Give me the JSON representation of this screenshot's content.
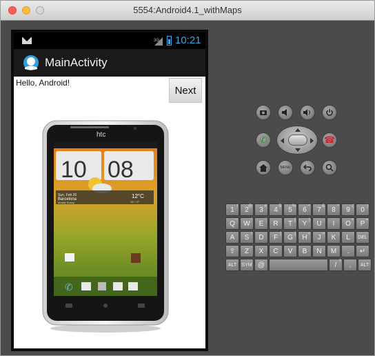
{
  "window": {
    "title": "5554:Android4.1_withMaps"
  },
  "status_bar": {
    "time": "10:21",
    "signal_label": "3G"
  },
  "action_bar": {
    "title": "MainActivity"
  },
  "content": {
    "hello_text": "Hello, Android!",
    "next_label": "Next"
  },
  "device_image": {
    "brand": "htc",
    "clock_hours": "10",
    "clock_minutes": "08",
    "city": "Barcelona",
    "weather": "Mostly Sunny",
    "date": "Sun, Feb 26",
    "temp": "12°C",
    "temp_range": "16° / 9°"
  },
  "controls": {
    "camera_label": "camera",
    "vol_down_label": "volume-down",
    "vol_up_label": "volume-up",
    "power_label": "power",
    "menu_label": "MENU"
  },
  "keyboard": {
    "rows": [
      [
        {
          "k": "1",
          "a": "!"
        },
        {
          "k": "2",
          "a": "@"
        },
        {
          "k": "3",
          "a": "#"
        },
        {
          "k": "4",
          "a": "$"
        },
        {
          "k": "5",
          "a": "%"
        },
        {
          "k": "6",
          "a": "^"
        },
        {
          "k": "7",
          "a": "&"
        },
        {
          "k": "8",
          "a": "*"
        },
        {
          "k": "9",
          "a": "("
        },
        {
          "k": "0",
          "a": ")"
        }
      ],
      [
        {
          "k": "Q",
          "a": "~"
        },
        {
          "k": "W",
          "a": "\""
        },
        {
          "k": "E",
          "a": "`"
        },
        {
          "k": "R",
          "a": ""
        },
        {
          "k": "T",
          "a": "{"
        },
        {
          "k": "Y",
          "a": "}"
        },
        {
          "k": "U",
          "a": "-"
        },
        {
          "k": "I",
          "a": ""
        },
        {
          "k": "O",
          "a": "+"
        },
        {
          "k": "P",
          "a": "="
        }
      ],
      [
        {
          "k": "A",
          "a": ""
        },
        {
          "k": "S",
          "a": "\\"
        },
        {
          "k": "D",
          "a": ""
        },
        {
          "k": "F",
          "a": "["
        },
        {
          "k": "G",
          "a": "]"
        },
        {
          "k": "H",
          "a": "<"
        },
        {
          "k": "J",
          "a": ">"
        },
        {
          "k": "K",
          "a": ";"
        },
        {
          "k": "L",
          "a": ":"
        },
        {
          "k": "DEL",
          "a": ""
        }
      ],
      [
        {
          "k": "⇧",
          "a": ""
        },
        {
          "k": "Z",
          "a": ""
        },
        {
          "k": "X",
          "a": ""
        },
        {
          "k": "C",
          "a": ""
        },
        {
          "k": "V",
          "a": ""
        },
        {
          "k": "B",
          "a": ""
        },
        {
          "k": "N",
          "a": ""
        },
        {
          "k": "M",
          "a": ""
        },
        {
          "k": ".",
          "a": ""
        },
        {
          "k": "↵",
          "a": ""
        }
      ],
      [
        {
          "k": "ALT",
          "a": ""
        },
        {
          "k": "SYM",
          "a": ""
        },
        {
          "k": "@",
          "a": ""
        },
        {
          "k": "",
          "a": ""
        },
        {
          "k": "/",
          "a": "?"
        },
        {
          "k": ",",
          "a": ""
        },
        {
          "k": "ALT",
          "a": ""
        }
      ]
    ]
  },
  "colors": {
    "accent": "#37a9e6",
    "call_green": "#2a8a2a",
    "end_red": "#c1272d"
  }
}
